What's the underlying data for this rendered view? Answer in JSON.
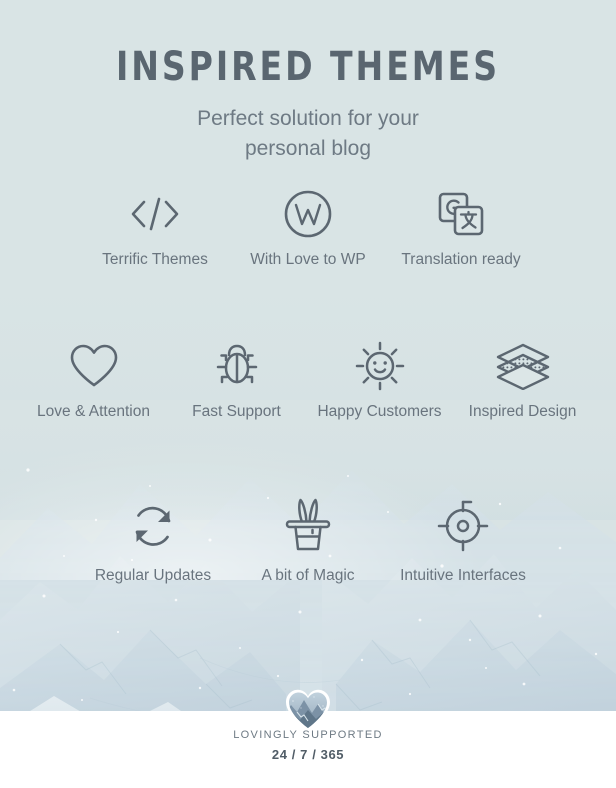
{
  "theme": {
    "background_color": "#d8e3e4",
    "text_color": "#69747e",
    "title_color": "#5a6670",
    "icon_color": "#5c6771",
    "footer_band_color": "#ffffff"
  },
  "header": {
    "title": "INSPIRED THEMES",
    "subtitle_line1": "Perfect solution for your",
    "subtitle_line2": "personal blog"
  },
  "features": {
    "row1": [
      {
        "label": "Terrific Themes",
        "icon": "code-brackets-icon"
      },
      {
        "label": "With Love to WP",
        "icon": "wordpress-icon"
      },
      {
        "label": "Translation ready",
        "icon": "google-translate-icon"
      }
    ],
    "row2": [
      {
        "label": "Love & Attention",
        "icon": "heart-outline-icon"
      },
      {
        "label": "Fast Support",
        "icon": "bug-icon"
      },
      {
        "label": "Happy Customers",
        "icon": "smiling-sun-icon"
      },
      {
        "label": "Inspired Design",
        "icon": "layers-icon"
      }
    ],
    "row3": [
      {
        "label": "Regular Updates",
        "icon": "refresh-arrows-icon"
      },
      {
        "label": "A bit of Magic",
        "icon": "magic-hat-rabbit-icon"
      },
      {
        "label": "Intuitive Interfaces",
        "icon": "crosshair-target-icon"
      }
    ]
  },
  "footer": {
    "logo_icon": "heart-photo-logo-icon",
    "supported_label": "LOVINGLY SUPPORTED",
    "uptime_label": "24 / 7 / 365"
  }
}
